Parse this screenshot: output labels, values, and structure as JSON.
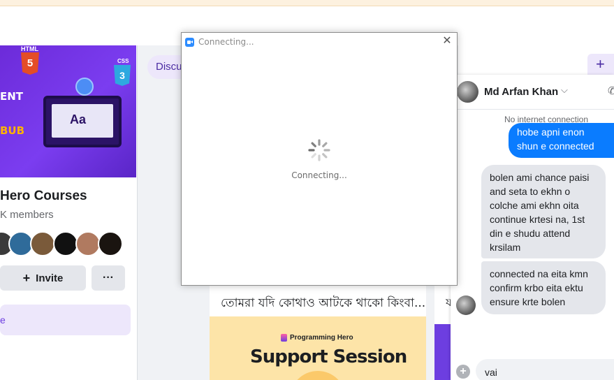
{
  "group": {
    "cover_text_1": "ENT",
    "cover_text_2": "BUB",
    "html_label": "HTML",
    "html_number": "5",
    "css_label": "CSS",
    "css_number": "3",
    "laptop_text": "Aa",
    "title": "Hero Courses",
    "members": "K members",
    "invite_label": "Invite",
    "more_label": "···",
    "side_text": "e"
  },
  "tabs": {
    "discussion_label": "Discu",
    "add_label": "+"
  },
  "post": {
    "small_text": "...",
    "text": "তোমরা যদি কোথাও আটকে থাকো কিংবা...",
    "banner_brand": "Programming Hero",
    "banner_title": "Support Session",
    "side_glyph": "য"
  },
  "chat": {
    "contact_name": "Md Arfan Khan",
    "status": "No internet connection",
    "outgoing_message": "hobe apni enon shun e connected na",
    "incoming_message_1": "bolen ami chance paisi and seta to ekhn o colche ami ekhn oita continue krtesi na, 1st din e shudu attend krsilam",
    "incoming_message_2": "connected na eita kmn confirm krbo eita ektu ensure krte bolen",
    "input_value": "vai"
  },
  "dialog": {
    "title": "Connecting...",
    "status": "Connecting...",
    "close_label": "✕"
  },
  "colors": {
    "accent": "#6d3ee0",
    "messenger_blue": "#0a7cff",
    "zoom_blue": "#2d8cff"
  }
}
